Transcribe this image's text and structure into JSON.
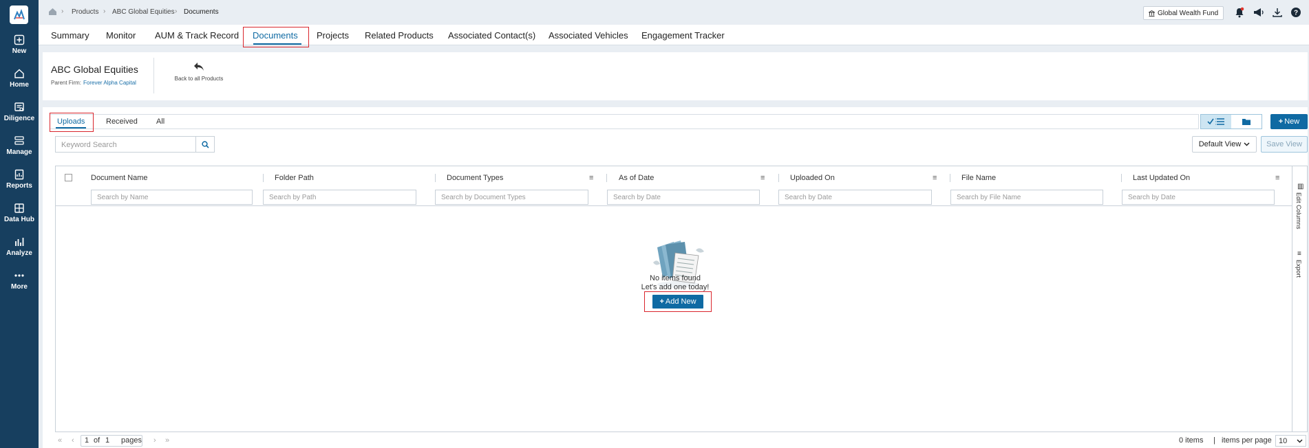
{
  "nav": [
    {
      "label": "New",
      "icon": "plus-square-icon"
    },
    {
      "label": "Home",
      "icon": "home-icon"
    },
    {
      "label": "Diligence",
      "icon": "diligence-icon"
    },
    {
      "label": "Manage",
      "icon": "manage-icon"
    },
    {
      "label": "Reports",
      "icon": "reports-icon"
    },
    {
      "label": "Data Hub",
      "icon": "data-hub-icon"
    },
    {
      "label": "Analyze",
      "icon": "bar-chart-icon"
    },
    {
      "label": "More",
      "icon": "more-dots-icon"
    }
  ],
  "breadcrumb": {
    "products": "Products",
    "product": "ABC Global Equities",
    "current": "Documents"
  },
  "topbar": {
    "fund": "Global Wealth Fund"
  },
  "tabs": [
    "Summary",
    "Monitor",
    "AUM & Track Record",
    "Documents",
    "Projects",
    "Related Products",
    "Associated Contact(s)",
    "Associated Vehicles",
    "Engagement Tracker"
  ],
  "header": {
    "title": "ABC Global Equities",
    "parent_label": "Parent Firm:",
    "parent_value": "Forever Alpha Capital",
    "back_label": "Back to all Products"
  },
  "subtabs": [
    "Uploads",
    "Received",
    "All"
  ],
  "toolbar": {
    "new_label": "New",
    "search_placeholder": "Keyword Search",
    "default_view": "Default View",
    "save_view": "Save View"
  },
  "columns": [
    {
      "title": "Document Name",
      "filter": "Search by Name"
    },
    {
      "title": "Folder Path",
      "filter": "Search by Path"
    },
    {
      "title": "Document Types",
      "filter": "Search by Document Types"
    },
    {
      "title": "As of Date",
      "filter": "Search by Date"
    },
    {
      "title": "Uploaded On",
      "filter": "Search by Date"
    },
    {
      "title": "File Name",
      "filter": "Search by File Name"
    },
    {
      "title": "Last Updated On",
      "filter": "Search by Date"
    }
  ],
  "rail": {
    "edit_columns": "Edit Columns",
    "export": "Export"
  },
  "empty": {
    "line1": "No items found",
    "line2": "Let's add one today!",
    "add_label": "Add New"
  },
  "pager": {
    "page": "1",
    "of": "of",
    "total": "1",
    "pages": "pages",
    "items": "0 items",
    "per_page_label": "items per page",
    "per_page": "10"
  },
  "colors": {
    "sidebar": "#173f5f",
    "accent": "#0f6aa3",
    "highlight": "#d9242b"
  }
}
